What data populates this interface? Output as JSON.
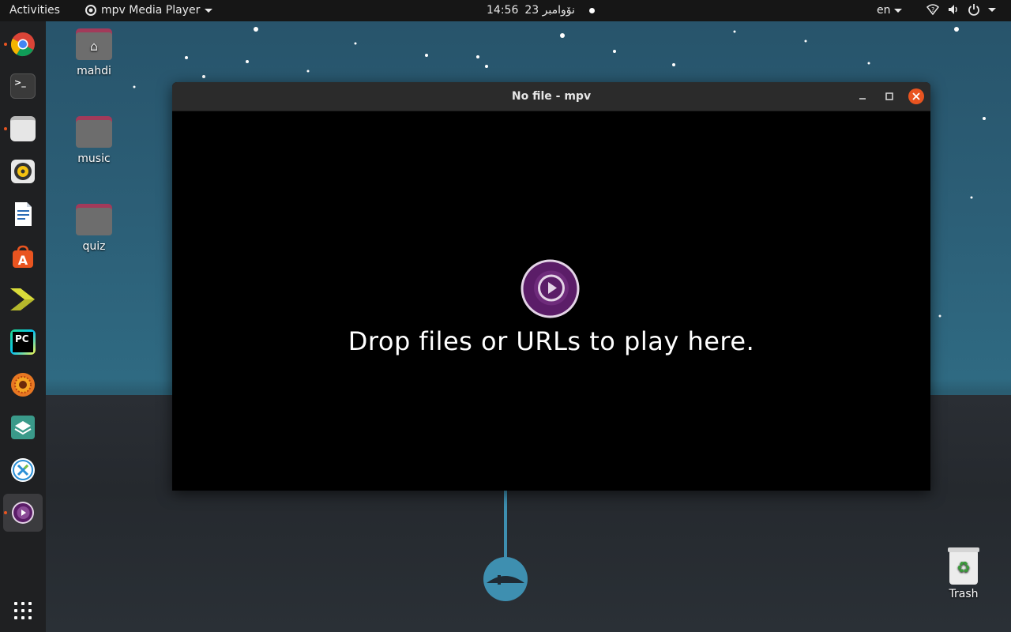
{
  "topbar": {
    "activities": "Activities",
    "app_name": "mpv Media Player",
    "clock_time": "14:56",
    "clock_date": "23 نۆوامبر",
    "lang": "en"
  },
  "dock": {
    "items": [
      {
        "name": "chrome",
        "icon": "chrome-icon",
        "running": true
      },
      {
        "name": "terminal",
        "icon": "terminal-icon",
        "running": false
      },
      {
        "name": "files",
        "icon": "files-icon",
        "running": true
      },
      {
        "name": "rhythmbox",
        "icon": "rhythmbox-icon",
        "running": false
      },
      {
        "name": "libreoffice-writer",
        "icon": "writer-icon",
        "running": false
      },
      {
        "name": "software-center",
        "icon": "software-icon",
        "running": false
      },
      {
        "name": "app-arrow",
        "icon": "arrow-app-icon",
        "running": false
      },
      {
        "name": "pycharm",
        "icon": "pycharm-icon",
        "running": false
      },
      {
        "name": "sunflower-app",
        "icon": "flower-icon",
        "running": false
      },
      {
        "name": "book-app",
        "icon": "book-icon",
        "running": false
      },
      {
        "name": "x-app",
        "icon": "x-app-icon",
        "running": false
      },
      {
        "name": "mpv",
        "icon": "mpv-icon",
        "running": true,
        "active": true
      }
    ],
    "show_apps": "grid-icon",
    "pycharm_label": "PC"
  },
  "desktop": {
    "icons": [
      {
        "label": "mahdi"
      },
      {
        "label": "music"
      },
      {
        "label": "quiz"
      }
    ],
    "trash_label": "Trash"
  },
  "window": {
    "title": "No file - mpv",
    "drop_text": "Drop files or URLs to play here."
  },
  "colors": {
    "accent": "#e95420",
    "mpv_purple": "#5b1d68",
    "titlebar": "#2b2b2b"
  }
}
